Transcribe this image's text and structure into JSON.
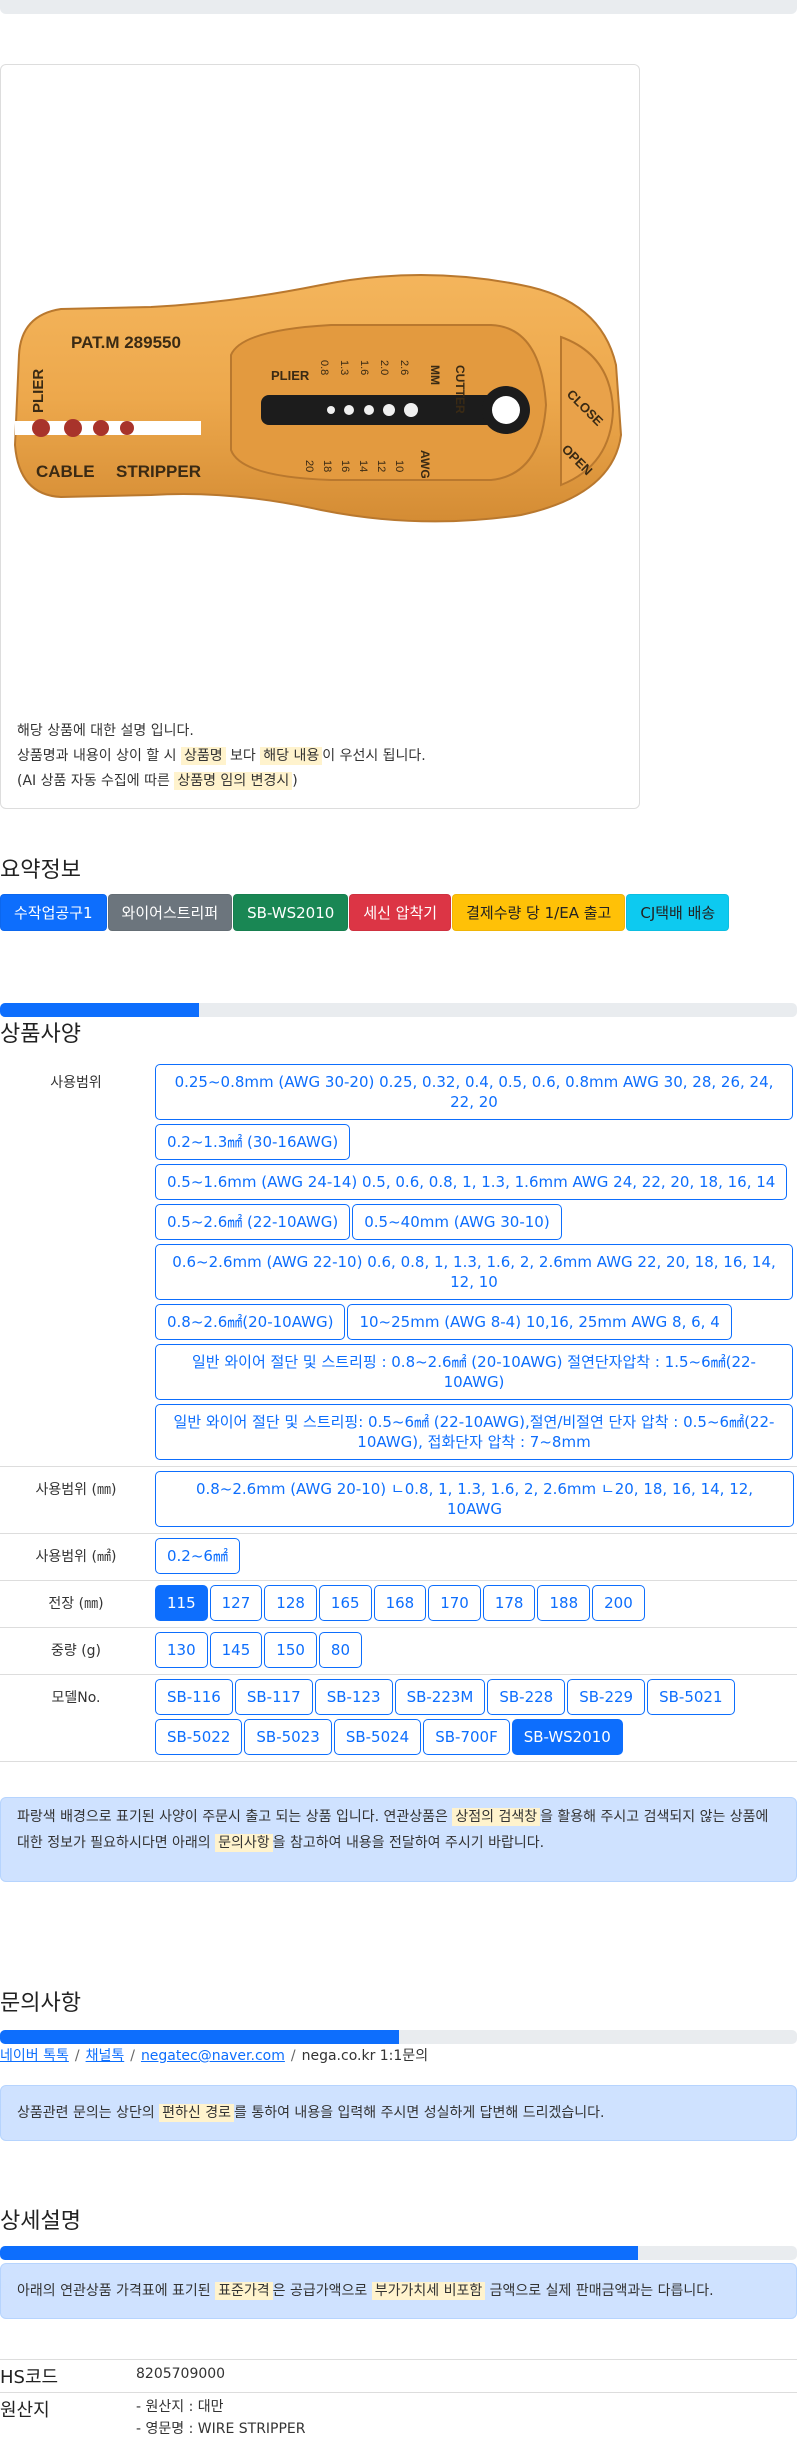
{
  "product_image": {
    "pat_text": "PAT.M 289550",
    "plier": "PLIER",
    "cable": "CABLE",
    "stripper": "STRIPPER",
    "mm": "MM",
    "cutter": "CUTTER",
    "awg": "AWG",
    "close": "CLOSE",
    "open": "OPEN",
    "mm_values": [
      "0.8",
      "1.3",
      "1.6",
      "2.0",
      "2.6"
    ],
    "awg_values": [
      "20",
      "18",
      "16",
      "14",
      "12",
      "10"
    ]
  },
  "description": {
    "line1": "해당 상품에 대한 설명 입니다.",
    "line2_a": "상품명과 내용이 상이 할 시 ",
    "line2_hl1": "상품명",
    "line2_b": " 보다 ",
    "line2_hl2": "해당 내용",
    "line2_c": "이 우선시 됩니다.",
    "line3_a": "(AI 상품 자동 수집에 따른 ",
    "line3_hl": "상품명 임의 변경시",
    "line3_b": ")"
  },
  "summary": {
    "title": "요약정보",
    "tags": [
      {
        "label": "수작업공구1",
        "color": "#0d6efd"
      },
      {
        "label": "와이어스트리퍼",
        "color": "#6c757d"
      },
      {
        "label": "SB-WS2010",
        "color": "#198754"
      },
      {
        "label": "세신 압착기",
        "color": "#dc3545"
      },
      {
        "label": "결제수량 당 1/EA 출고",
        "color": "#ffc107"
      },
      {
        "label": "CJ택배 배송",
        "color": "#0dcaf0"
      }
    ]
  },
  "spec": {
    "title": "상품사양",
    "progress": 0.25,
    "rows": [
      {
        "key": "사용범위",
        "chips": [
          {
            "label": "0.25~0.8mm (AWG 30-20) 0.25, 0.32, 0.4, 0.5, 0.6, 0.8mm AWG 30, 28, 26, 24, 22, 20",
            "full": true
          },
          {
            "label": "0.2~1.3㎟ (30-16AWG)"
          },
          {
            "label": "0.5~1.6mm (AWG 24-14) 0.5, 0.6, 0.8, 1, 1.3, 1.6mm AWG 24, 22, 20, 18, 16, 14"
          },
          {
            "label": "0.5~2.6㎟ (22-10AWG)"
          },
          {
            "label": "0.5~40mm (AWG 30-10)"
          },
          {
            "label": "0.6~2.6mm (AWG 22-10) 0.6, 0.8, 1, 1.3, 1.6, 2, 2.6mm AWG 22, 20, 18, 16, 14, 12, 10",
            "full": true
          },
          {
            "label": "0.8~2.6㎟(20-10AWG)"
          },
          {
            "label": "10~25mm (AWG 8-4) 10,16, 25mm AWG 8, 6, 4"
          },
          {
            "label": "일반 와이어 절단 및 스트리핑 : 0.8~2.6㎟ (20-10AWG) 절연단자압착 : 1.5~6㎟(22-10AWG)",
            "full": true
          },
          {
            "label": "일반 와이어 절단 및 스트리핑: 0.5~6㎟ (22-10AWG),절연/비절연 단자 압착 : 0.5~6㎟(22-10AWG), 접화단자 압착 : 7~8mm",
            "full": true
          }
        ]
      },
      {
        "key": "사용범위 (㎜)",
        "chips": [
          {
            "label": "0.8~2.6mm (AWG 20-10) ㄴ0.8, 1, 1.3, 1.6, 2, 2.6mm ㄴ20, 18, 16, 14, 12, 10AWG"
          }
        ]
      },
      {
        "key": "사용범위 (㎟)",
        "chips": [
          {
            "label": "0.2~6㎟"
          }
        ]
      },
      {
        "key": "전장 (㎜)",
        "chips": [
          {
            "label": "115",
            "selected": true
          },
          {
            "label": "127"
          },
          {
            "label": "128"
          },
          {
            "label": "165"
          },
          {
            "label": "168"
          },
          {
            "label": "170"
          },
          {
            "label": "178"
          },
          {
            "label": "188"
          },
          {
            "label": "200"
          }
        ]
      },
      {
        "key": "중량 (g)",
        "chips": [
          {
            "label": "130"
          },
          {
            "label": "145"
          },
          {
            "label": "150"
          },
          {
            "label": "80"
          }
        ]
      },
      {
        "key": "모델No.",
        "chips": [
          {
            "label": "SB-116"
          },
          {
            "label": "SB-117"
          },
          {
            "label": "SB-123"
          },
          {
            "label": "SB-223M"
          },
          {
            "label": "SB-228"
          },
          {
            "label": "SB-229"
          },
          {
            "label": "SB-5021"
          },
          {
            "label": "SB-5022"
          },
          {
            "label": "SB-5023"
          },
          {
            "label": "SB-5024"
          },
          {
            "label": "SB-700F"
          },
          {
            "label": "SB-WS2010",
            "selected": true
          }
        ]
      }
    ],
    "note_a": "파랑색 배경으로 표기된 사양이 주문시 출고 되는 상품 입니다. 연관상품은 ",
    "note_hl1": "상점의 검색창",
    "note_b": "을 활용해 주시고 검색되지 않는 상품에 대한 정보가 필요하시다면 아래의 ",
    "note_hl2": "문의사항",
    "note_c": "을 참고하여 내용을 전달하여 주시기 바랍니다."
  },
  "inquiry": {
    "title": "문의사항",
    "progress": 0.5,
    "links": [
      "네이버 톡톡",
      "채널톡",
      "negatec@naver.com"
    ],
    "plain": "nega.co.kr 1:1문의",
    "sep": "/",
    "note_a": "상품관련 문의는 상단의 ",
    "note_hl": "편하신 경로",
    "note_b": "를 통하여 내용을 입력해 주시면 성실하게 답변해 드리겠습니다."
  },
  "detail": {
    "title": "상세설명",
    "progress": 0.8,
    "note_a": "아래의 연관상품 가격표에 표기된 ",
    "note_hl1": "표준가격",
    "note_b": "은 공급가액으로 ",
    "note_hl2": "부가가치세 비포함",
    "note_c": " 금액으로 실제 판매금액과는 다릅니다."
  },
  "info": {
    "hs_key": "HS코드",
    "hs_value": "8205709000",
    "origin_key": "원산지",
    "origin_line1": "- 원산지 : 대만",
    "origin_line2": "- 영문명 : WIRE STRIPPER"
  }
}
